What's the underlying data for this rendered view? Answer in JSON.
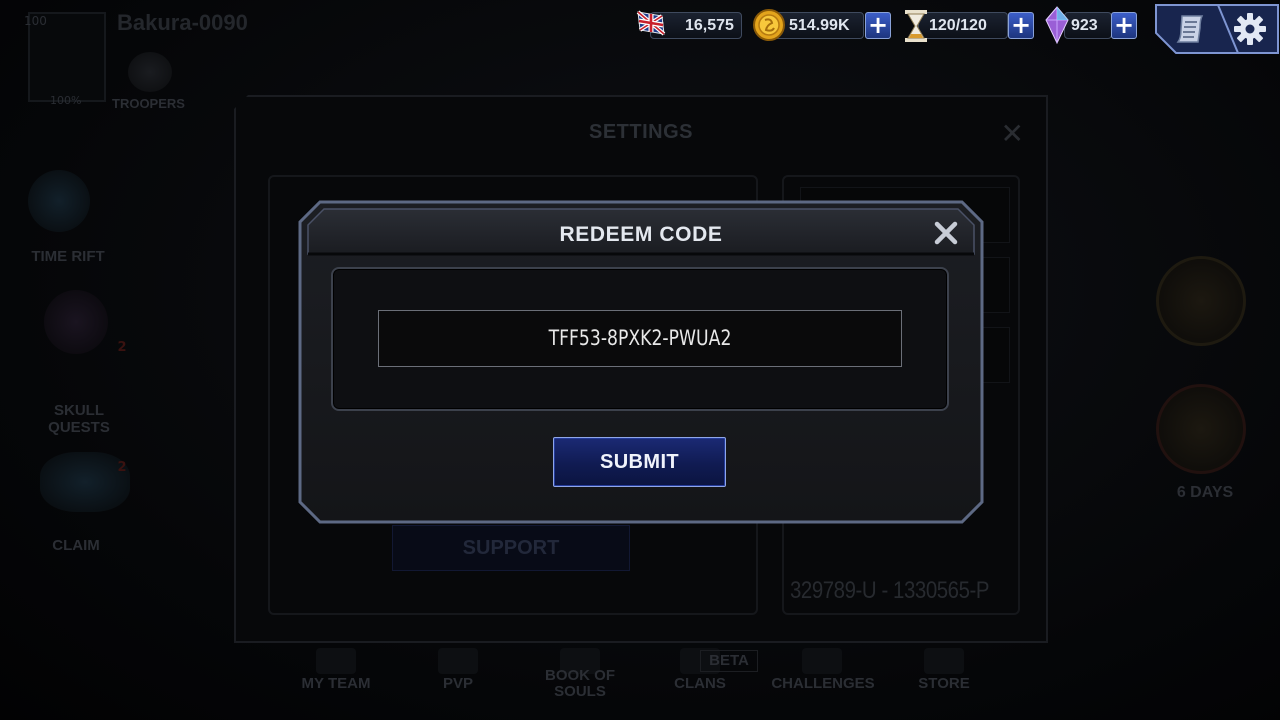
{
  "player": {
    "name": "Bakura-0090",
    "level": "100",
    "progress_label": "100%",
    "progress": 1.0
  },
  "troopers": {
    "label": "TROOPERS"
  },
  "side_menu": [
    {
      "label": "TIME RIFT",
      "badge": ""
    },
    {
      "label": "SKULL QUESTS",
      "badge": "2"
    },
    {
      "label": "CLAIM",
      "badge": "2"
    }
  ],
  "right_event": {
    "timer": "6 DAYS"
  },
  "hud": {
    "flag_value": "16,575",
    "gold": "514.99K",
    "energy": "120/120",
    "crystals": "923",
    "plus_label": "+"
  },
  "bottom_nav": [
    {
      "label": "MY TEAM"
    },
    {
      "label": "PVP"
    },
    {
      "label": "BOOK OF SOULS"
    },
    {
      "label": "CLANS"
    },
    {
      "label": "CHALLENGES"
    },
    {
      "label": "STORE"
    }
  ],
  "beta_tag": "BETA",
  "settings": {
    "title": "SETTINGS",
    "support_label": "SUPPORT",
    "player_id": "329789-U - 1330565-P"
  },
  "dialog": {
    "title": "REDEEM CODE",
    "code_value": "TFF53-8PXK2-PWUA2",
    "submit_label": "SUBMIT"
  },
  "colors": {
    "accent": "#1d357e",
    "button_border": "#8fa6e8",
    "frame": "#5d6984"
  }
}
